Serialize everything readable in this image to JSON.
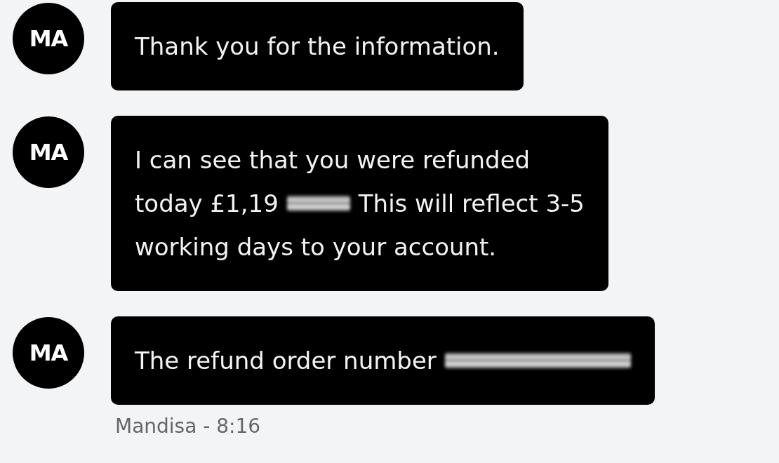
{
  "messages": [
    {
      "avatar": "MA",
      "lines": [
        [
          {
            "kind": "text",
            "text": "Thank you for the information."
          }
        ]
      ]
    },
    {
      "avatar": "MA",
      "lines": [
        [
          {
            "kind": "text",
            "text": "I can see that you were refunded"
          }
        ],
        [
          {
            "kind": "text",
            "text": "today £1,19"
          },
          {
            "kind": "redacted"
          },
          {
            "kind": "text",
            "text": "This will reflect 3-5"
          }
        ],
        [
          {
            "kind": "text",
            "text": "working days to your account."
          }
        ]
      ]
    },
    {
      "avatar": "MA",
      "lines": [
        [
          {
            "kind": "text",
            "text": "The refund order number"
          },
          {
            "kind": "redacted_long"
          }
        ]
      ]
    }
  ],
  "footer": {
    "sender": "Mandisa - 8:16"
  }
}
